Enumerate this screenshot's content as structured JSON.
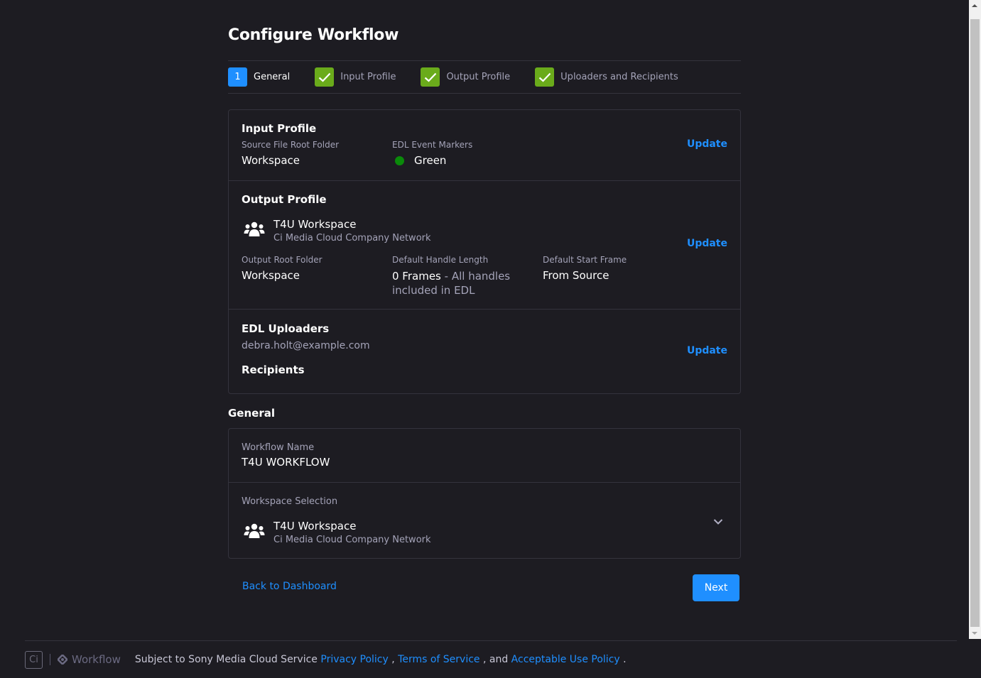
{
  "page": {
    "title": "Configure Workflow"
  },
  "stepper": {
    "steps": [
      {
        "badge": "1",
        "label": "General",
        "state": "active"
      },
      {
        "badge": "check",
        "label": "Input Profile",
        "state": "done"
      },
      {
        "badge": "check",
        "label": "Output Profile",
        "state": "done"
      },
      {
        "badge": "check",
        "label": "Uploaders and Recipients",
        "state": "done"
      }
    ]
  },
  "summary": {
    "input_profile": {
      "title": "Input Profile",
      "source_folder_label": "Source File Root Folder",
      "source_folder_value": "Workspace",
      "markers_label": "EDL Event Markers",
      "markers_value": "Green",
      "markers_color": "#0a8a0a",
      "update_label": "Update"
    },
    "output_profile": {
      "title": "Output Profile",
      "workspace_icon": "users-group-icon",
      "workspace_name": "T4U Workspace",
      "workspace_network": "Ci Media Cloud Company Network",
      "root_folder_label": "Output Root Folder",
      "root_folder_value": "Workspace",
      "handle_label": "Default Handle Length",
      "handle_value": "0 Frames",
      "handle_note": " - All handles included in EDL",
      "start_frame_label": "Default Start Frame",
      "start_frame_value": "From Source",
      "update_label": "Update"
    },
    "uploaders": {
      "title": "EDL Uploaders",
      "email": "debra.holt@example.com",
      "recipients_title": "Recipients",
      "update_label": "Update"
    }
  },
  "general": {
    "title": "General",
    "workflow_name_label": "Workflow Name",
    "workflow_name_value": "T4U WORKFLOW",
    "workspace_selection_label": "Workspace Selection",
    "workspace_icon": "users-group-icon",
    "workspace_name": "T4U Workspace",
    "workspace_network": "Ci Media Cloud Company Network"
  },
  "actions": {
    "back_label": "Back to Dashboard",
    "next_label": "Next"
  },
  "footer": {
    "logo_text": "Ci",
    "app_name": "Workflow",
    "text_prefix": "Subject to Sony Media Cloud Service ",
    "privacy_label": "Privacy Policy",
    "sep1": " , ",
    "terms_label": "Terms of Service",
    "sep2": " , and ",
    "aup_label": "Acceptable Use Policy",
    "suffix": " ."
  },
  "colors": {
    "accent": "#1f8fff",
    "success": "#6aab1b",
    "background": "#1d1c22",
    "border": "#34333d"
  }
}
